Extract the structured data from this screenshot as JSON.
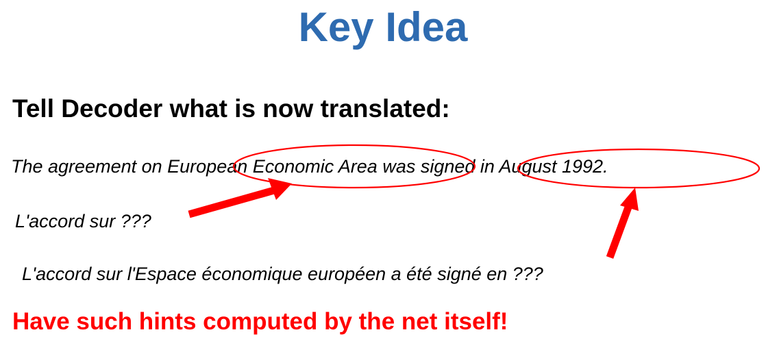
{
  "slide": {
    "title": "Key Idea",
    "heading": "Tell Decoder what is now translated:",
    "source_sentence": "The agreement on European Economic Area was signed in August 1992.",
    "partial_translation_1": "L'accord sur ???",
    "partial_translation_2": "L'accord sur l'Espace économique européen a été signé en ???",
    "conclusion": "Have such hints computed by the net itself!"
  },
  "colors": {
    "title": "#2e6bb0",
    "conclusion": "#ff0000",
    "annotation": "#ff0000",
    "text": "#000000"
  },
  "annotations": [
    {
      "type": "ellipse",
      "highlights": "European Economic Area was"
    },
    {
      "type": "ellipse",
      "highlights": "in August 1992."
    },
    {
      "type": "arrow",
      "from": "L'accord sur ???",
      "to": "European Economic Area was"
    },
    {
      "type": "arrow",
      "from": "L'accord sur l'Espace économique européen a été signé en ???",
      "to": "in August 1992."
    }
  ]
}
